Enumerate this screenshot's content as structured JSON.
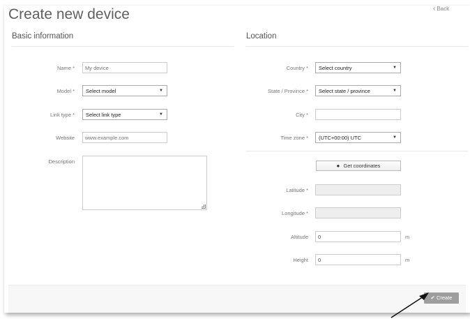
{
  "page": {
    "title": "Create new device",
    "back_label": "Back"
  },
  "basic": {
    "title": "Basic information",
    "name": {
      "label": "Name *",
      "placeholder": "My device"
    },
    "model": {
      "label": "Model *",
      "value": "Select model"
    },
    "link_type": {
      "label": "Link type *",
      "value": "Select link type"
    },
    "website": {
      "label": "Website",
      "placeholder": "www.example.com"
    },
    "description": {
      "label": "Description"
    }
  },
  "location": {
    "title": "Location",
    "country": {
      "label": "Country *",
      "value": "Select country"
    },
    "state": {
      "label": "State / Province *",
      "value": "Select state / province"
    },
    "city": {
      "label": "City *",
      "value": ""
    },
    "timezone": {
      "label": "Time zone *",
      "value": "(UTC+00:00) UTC"
    },
    "get_coords_label": "Get coordinates",
    "latitude": {
      "label": "Latitude *",
      "value": ""
    },
    "longitude": {
      "label": "Longitude *",
      "value": ""
    },
    "altitude": {
      "label": "Altitude",
      "value": "0",
      "unit": "m"
    },
    "height": {
      "label": "Height",
      "value": "0",
      "unit": "m"
    }
  },
  "footer": {
    "create_label": "Create"
  },
  "icons": {
    "back": "chevron-left-icon",
    "globe": "globe-icon",
    "check": "check-icon",
    "arrow": "cursor-arrow"
  }
}
